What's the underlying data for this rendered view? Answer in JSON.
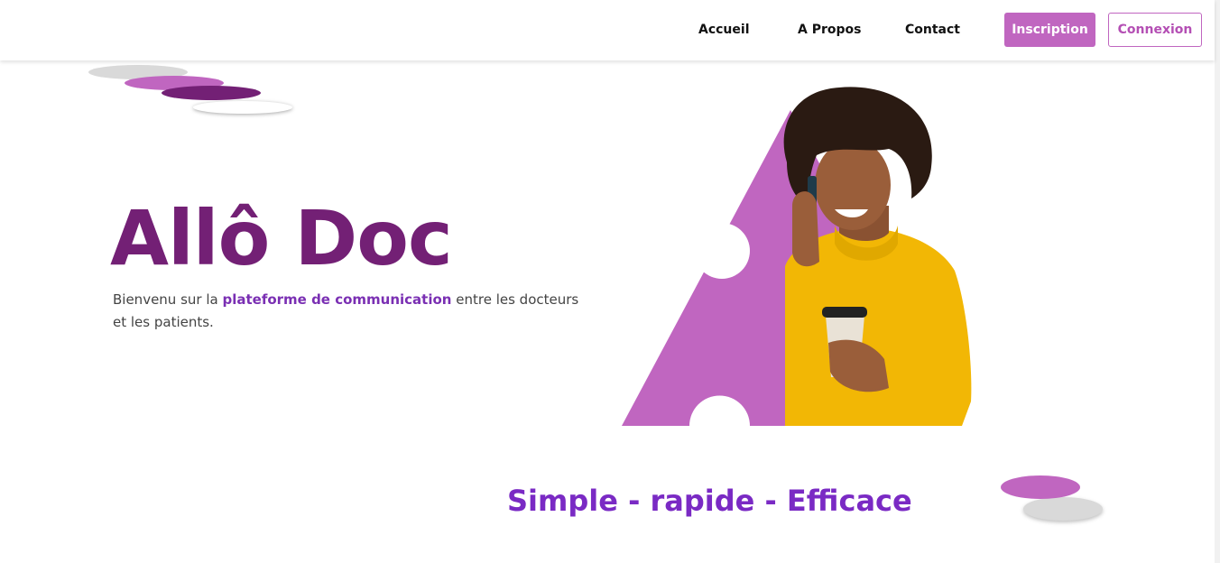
{
  "nav": {
    "links": [
      {
        "label": "Accueil"
      },
      {
        "label": "A Propos"
      },
      {
        "label": "Contact"
      }
    ],
    "signup_label": "Inscription",
    "login_label": "Connexion"
  },
  "hero": {
    "title": "Allô Doc",
    "text_before": "Bienvenu sur la ",
    "text_highlight": "plateforme de communication",
    "text_after": " entre les docteurs et les patients.",
    "image_icon": "woman-on-phone-with-coffee-illustration"
  },
  "tagline": "Simple - rapide - Efficace",
  "colors": {
    "brand": "#732075",
    "accent": "#c066c0",
    "highlight": "#7a2fb3",
    "tagline": "#7a2ac4",
    "sweater": "#f2b705"
  }
}
